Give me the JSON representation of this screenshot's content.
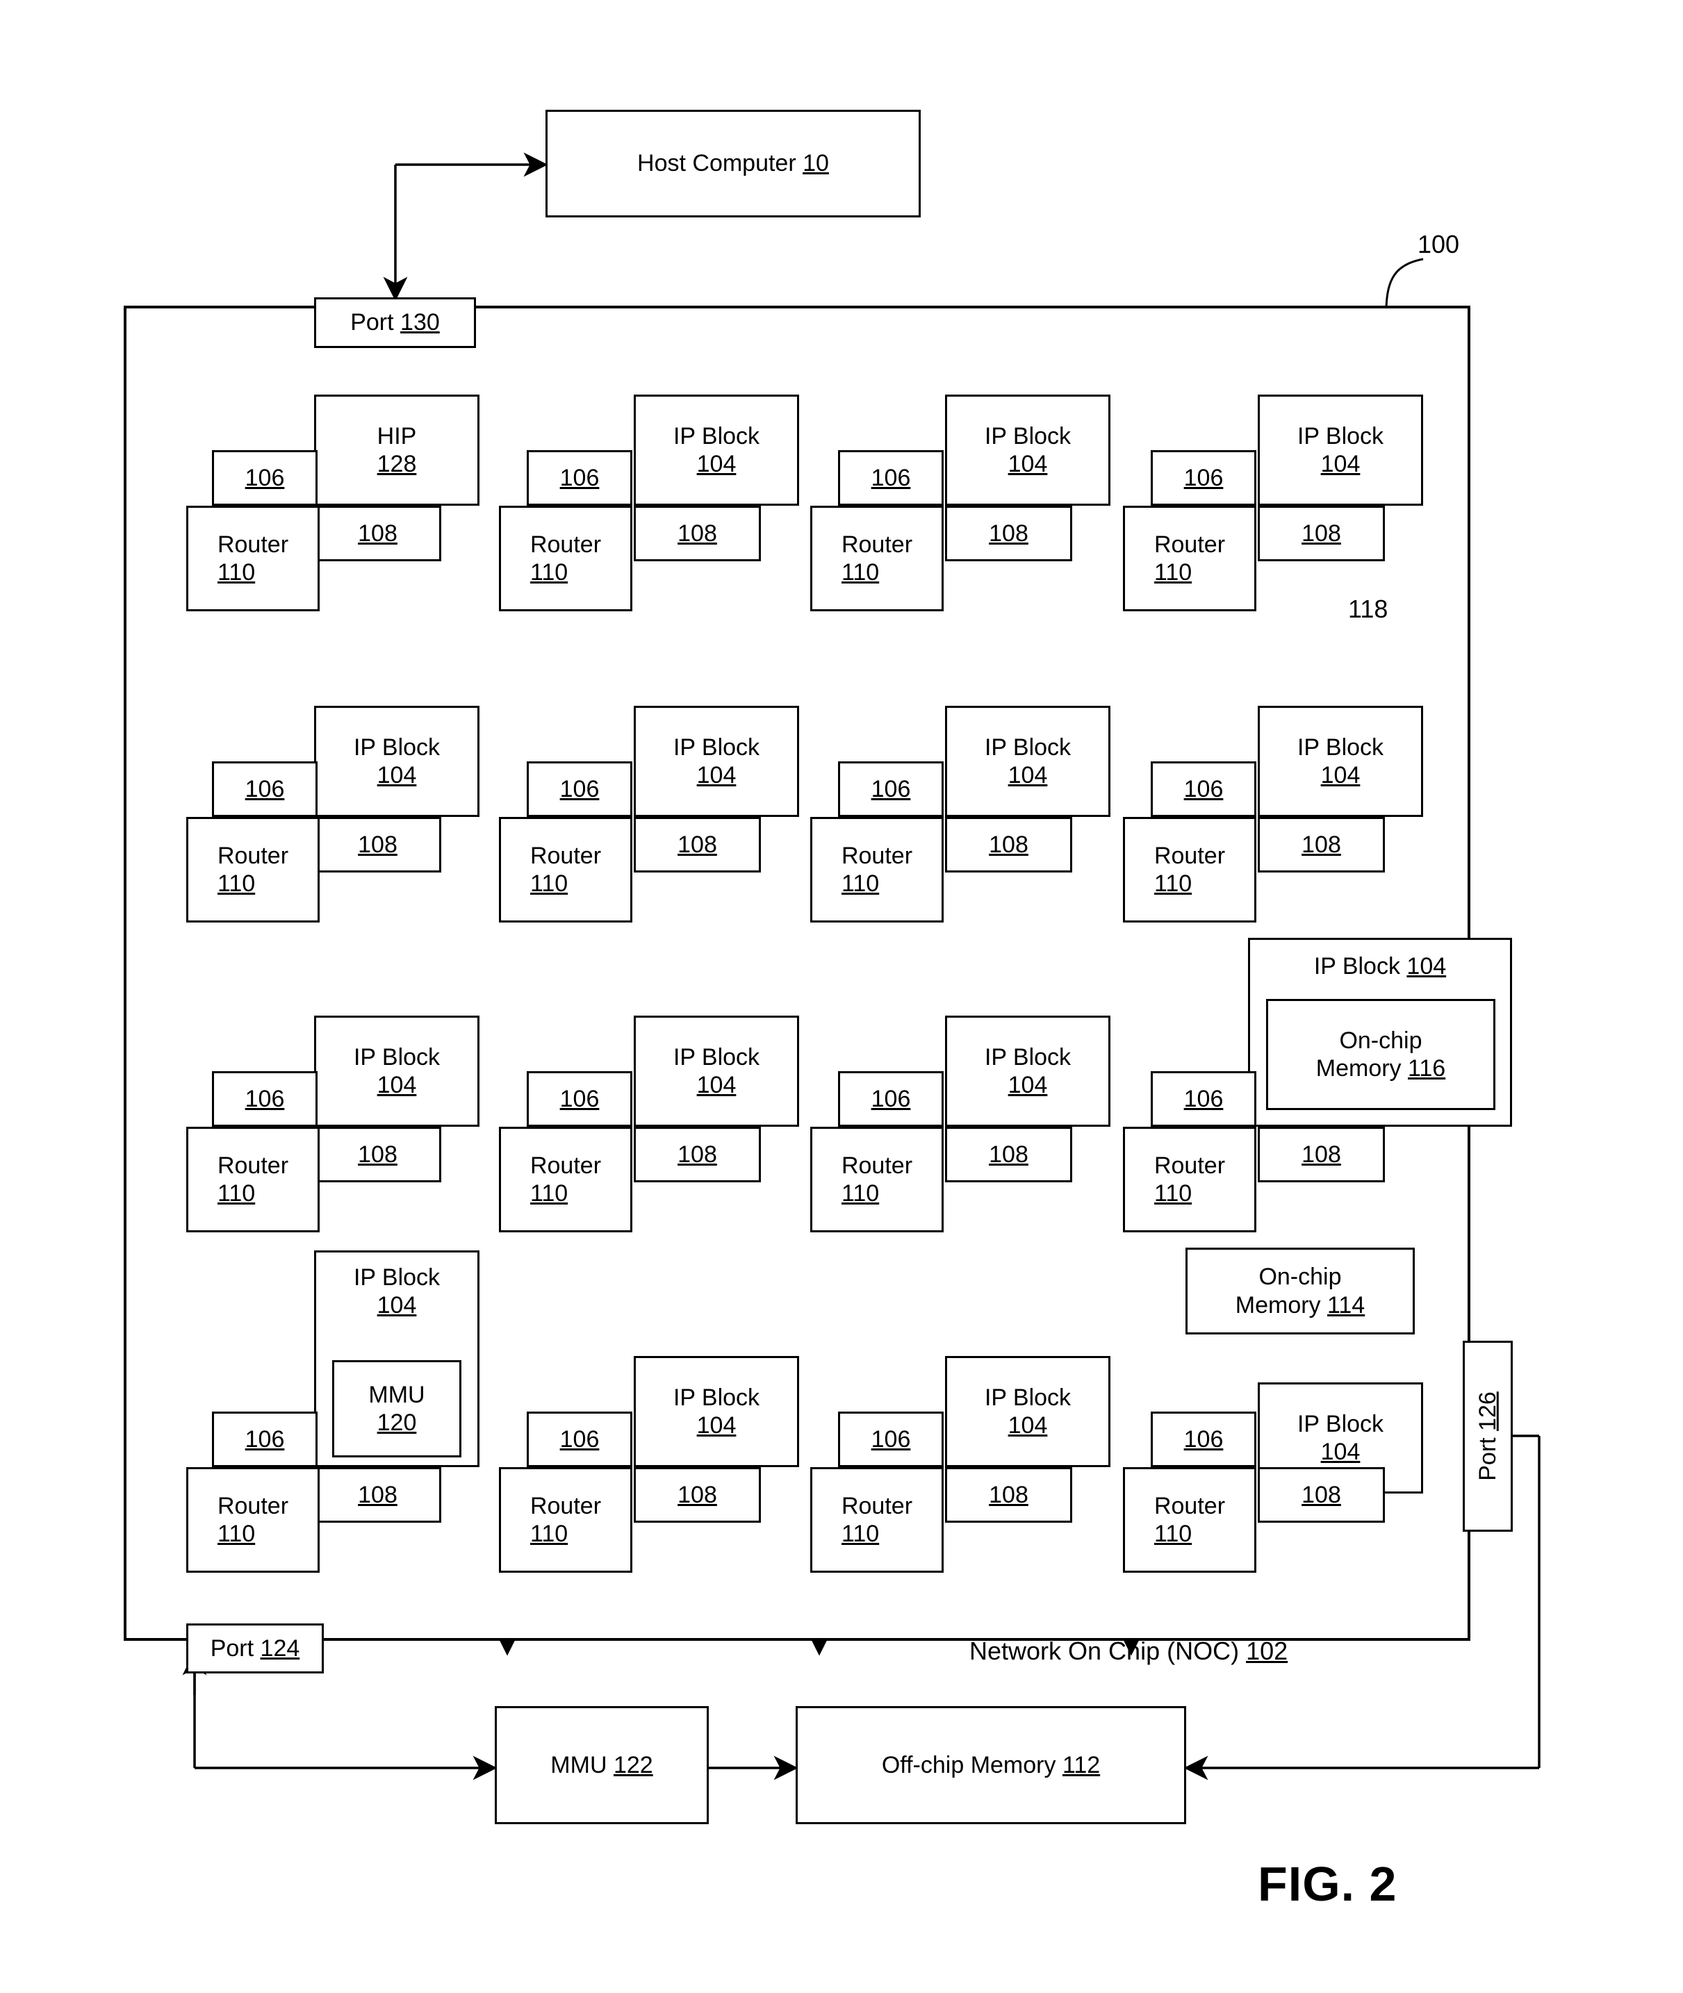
{
  "figure": {
    "label": "FIG. 2",
    "diagram_ref": "100",
    "link_ref": "118"
  },
  "host": {
    "label": "Host Computer ",
    "ref": "10"
  },
  "noc": {
    "title_text": "Network On Chip (NOC) ",
    "title_ref": "102",
    "ports": {
      "top": {
        "label": "Port ",
        "ref": "130"
      },
      "bottom": {
        "label": "Port ",
        "ref": "124"
      },
      "right": {
        "label": "Port ",
        "ref": "126"
      }
    }
  },
  "external": {
    "mmu": {
      "label": "MMU ",
      "ref": "122"
    },
    "off_chip_memory": {
      "label": "Off-chip  Memory ",
      "ref": "112"
    }
  },
  "common": {
    "ip_block_label": "IP Block",
    "ip_block_ref": "104",
    "router_label": "Router",
    "router_ref": "110",
    "link_ref": "106",
    "adapter_ref": "108",
    "hip_label": "HIP",
    "hip_ref": "128",
    "mmu_label": "MMU",
    "mmu_ref": "120",
    "onchip_mem_label": "On-chip",
    "onchip_mem_116": "Memory 116",
    "onchip_mem_114": "Memory 114",
    "onchip_116_ref": "116",
    "onchip_114_ref": "114"
  },
  "grid": {
    "rows": 4,
    "cols": 4,
    "cells": [
      {
        "id": "r1c1",
        "core": "HIP",
        "core_label": "HIP",
        "core_ref": "128"
      },
      {
        "id": "r1c2",
        "core": "IP Block",
        "core_label": "IP Block",
        "core_ref": "104"
      },
      {
        "id": "r1c3",
        "core": "IP Block",
        "core_label": "IP Block",
        "core_ref": "104"
      },
      {
        "id": "r1c4",
        "core": "IP Block",
        "core_label": "IP Block",
        "core_ref": "104"
      },
      {
        "id": "r2c1",
        "core": "IP Block",
        "core_label": "IP Block",
        "core_ref": "104"
      },
      {
        "id": "r2c2",
        "core": "IP Block",
        "core_label": "IP Block",
        "core_ref": "104"
      },
      {
        "id": "r2c3",
        "core": "IP Block",
        "core_label": "IP Block",
        "core_ref": "104"
      },
      {
        "id": "r2c4",
        "core": "IP Block",
        "core_label": "IP Block",
        "core_ref": "104"
      },
      {
        "id": "r3c1",
        "core": "IP Block",
        "core_label": "IP Block",
        "core_ref": "104"
      },
      {
        "id": "r3c2",
        "core": "IP Block",
        "core_label": "IP Block",
        "core_ref": "104"
      },
      {
        "id": "r3c3",
        "core": "IP Block",
        "core_label": "IP Block",
        "core_ref": "104"
      },
      {
        "id": "r3c4",
        "core": "IP Block with On-chip Memory 116",
        "core_label": "IP Block 104",
        "core_ref": "104"
      },
      {
        "id": "r4c1",
        "core": "IP Block with MMU 120",
        "core_label": "IP Block",
        "core_ref": "104"
      },
      {
        "id": "r4c2",
        "core": "IP Block",
        "core_label": "IP Block",
        "core_ref": "104"
      },
      {
        "id": "r4c3",
        "core": "IP Block",
        "core_label": "IP Block",
        "core_ref": "104"
      },
      {
        "id": "r4c4",
        "core": "IP Block with external On-chip Memory 114",
        "core_label": "IP Block",
        "core_ref": "104"
      }
    ]
  },
  "text": {
    "ip_block_104_inline": "IP Block 104",
    "onchip116_line1": "On-chip",
    "onchip116_line2": "Memory 116",
    "onchip114_line1": "On-chip",
    "onchip114_line2": "Memory 114",
    "hip_line1": "HIP",
    "hip_line2": "128",
    "mmu120_line1": "MMU",
    "mmu120_line2": "120",
    "ipblock_line1": "IP Block",
    "ipblock_line2": "104",
    "router_line1": "Router",
    "router_line2": "110",
    "n106": "106",
    "n108": "108",
    "port130": "Port 130",
    "port124": "Port 124",
    "port126": "Port 126",
    "mmu122": "MMU 122",
    "offchip112": "Off-chip  Memory 112",
    "noc_title": "Network On Chip (NOC) 102",
    "host": "Host Computer 10",
    "ref100": "100",
    "ref118": "118",
    "fig": "FIG. 2"
  },
  "colors": {
    "stroke": "#000000",
    "background": "#ffffff"
  }
}
